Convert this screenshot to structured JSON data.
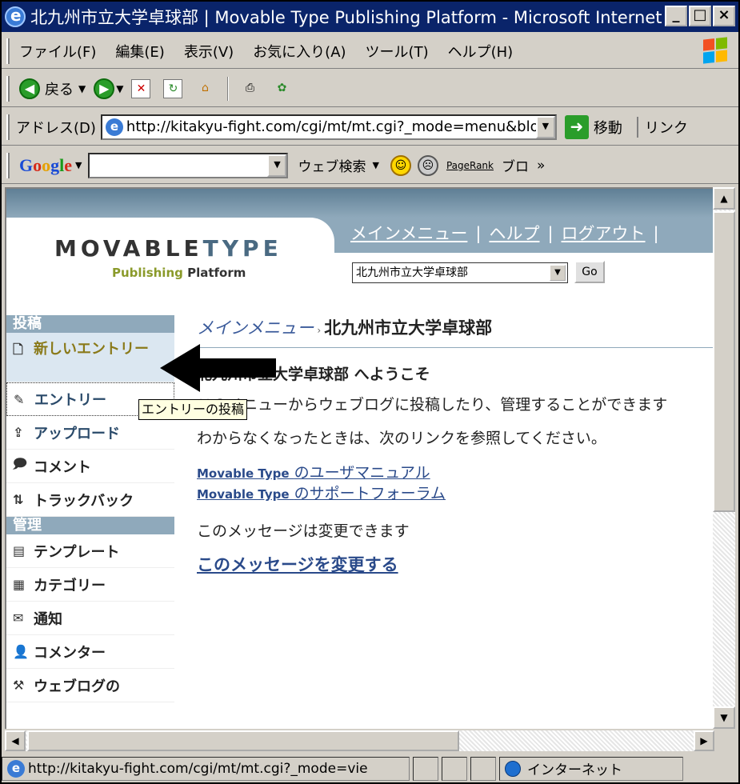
{
  "window": {
    "title": "北九州市立大学卓球部 | Movable Type Publishing Platform - Microsoft Internet ...",
    "minimize": "_",
    "maximize": "□",
    "close": "×"
  },
  "menubar": [
    "ファイル(F)",
    "編集(E)",
    "表示(V)",
    "お気に入り(A)",
    "ツール(T)",
    "ヘルプ(H)"
  ],
  "toolbar": {
    "back_label": "戻る"
  },
  "address": {
    "label": "アドレス(D)",
    "url": "http://kitakyu-fight.com/cgi/mt/mt.cgi?_mode=menu&blo",
    "go_label": "移動",
    "links_label": "リンク"
  },
  "google": {
    "logo": "Google",
    "search_value": "",
    "web_search_label": "ウェブ検索",
    "pagerank_label": "PageRank",
    "blog_label": "ブロ",
    "more": "»"
  },
  "mt": {
    "logo_main": "MOVABLE",
    "logo_type": "TYPE",
    "tagline_a": "Publishing",
    "tagline_b": "Platform",
    "nav": [
      "メインメニュー",
      "ヘルプ",
      "ログアウト"
    ],
    "blog_select": "北九州市立大学卓球部",
    "go_button": "Go"
  },
  "leftnav": {
    "section_post": "投稿",
    "new_entry": "新しいエントリー",
    "entries": "エントリー",
    "tooltip": "エントリーの投稿",
    "upload": "アップロード",
    "comments": "コメント",
    "trackback": "トラックバック",
    "section_manage": "管理",
    "templates": "テンプレート",
    "categories": "カテゴリー",
    "notify": "通知",
    "commenters": "コメンター",
    "weblog_settings": "ウェブログの"
  },
  "main": {
    "crumb_link": "メインメニュー",
    "crumb_current": "北九州市立大学卓球部",
    "welcome": "北九州市立大学卓球部 へようこそ",
    "intro": "このメニューからウェブログに投稿したり、管理することができます",
    "help_text": "わからなくなったときは、次のリンクを参照してください。",
    "manual_prefix": "Movable Type",
    "manual_suffix": "のユーザマニュアル",
    "forum_prefix": "Movable Type",
    "forum_suffix": "のサポートフォーラム",
    "editable_note": "このメッセージは変更できます",
    "change_link": "このメッセージを変更する"
  },
  "status": {
    "url": "http://kitakyu-fight.com/cgi/mt/mt.cgi?_mode=vie",
    "zone": "インターネット"
  },
  "colors": {
    "titlebar": "#0a246a",
    "mt_band": "#8fa9bb",
    "link": "#2a4a8a"
  }
}
